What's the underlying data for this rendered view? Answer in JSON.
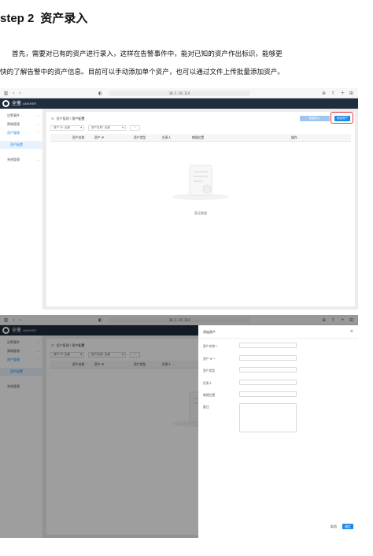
{
  "doc": {
    "step": "step 2",
    "title": "资产录入",
    "line1": "首先，需要对已有的资产进行录入，这样在告警事件中，能对已知的资产作出标识，能够更",
    "line2": "快的了解告警中的资产信息。目前可以手动添加单个资产，也可以通过文件上传批量添加资产。"
  },
  "browser": {
    "url": "10.2.19.114",
    "icons": [
      "sidebar-icon",
      "back-icon",
      "forward-icon",
      "shield-icon",
      "reload-icon",
      "download-icon",
      "share-icon",
      "plus-icon",
      "grid-icon"
    ]
  },
  "app": {
    "logo_text": "全鉴",
    "logo_sub": "AMSHER",
    "sidebar": [
      {
        "label": "告警事件",
        "chevron": "⌄"
      },
      {
        "label": "策略管理",
        "chevron": "⌄"
      },
      {
        "label": "资产管理",
        "chevron": "⌃"
      },
      {
        "label": "资产配置",
        "chevron": ""
      },
      {
        "label": "系统管理",
        "chevron": "⌄"
      }
    ],
    "breadcrumb": [
      "资产管理",
      "资产配置"
    ],
    "breadcrumb_sep": "/",
    "batch_button": "批量导入",
    "add_button": "添加资产",
    "filters": [
      {
        "label": "资产 IP: 全部"
      },
      {
        "label": "资产名称: 全部"
      },
      {
        "label": "···"
      }
    ],
    "columns": [
      "资产名称",
      "资产 IP",
      "资产类型",
      "负责人",
      "物理位置",
      "操作"
    ],
    "empty_text": "暂无数据"
  },
  "drawer": {
    "title": "添加资产",
    "close": "×",
    "fields": [
      {
        "label": "资产名称",
        "required": "*"
      },
      {
        "label": "资产 IP",
        "required": "*"
      },
      {
        "label": "资产类型",
        "required": ""
      },
      {
        "label": "负责人",
        "required": ""
      },
      {
        "label": "物理位置",
        "required": ""
      },
      {
        "label": "备注",
        "required": ""
      }
    ],
    "cancel": "取消",
    "ok": "确定"
  },
  "colors": {
    "nav_dark": "#1f2d3d",
    "primary": "#1e88e5",
    "highlight_red": "#e53935"
  }
}
